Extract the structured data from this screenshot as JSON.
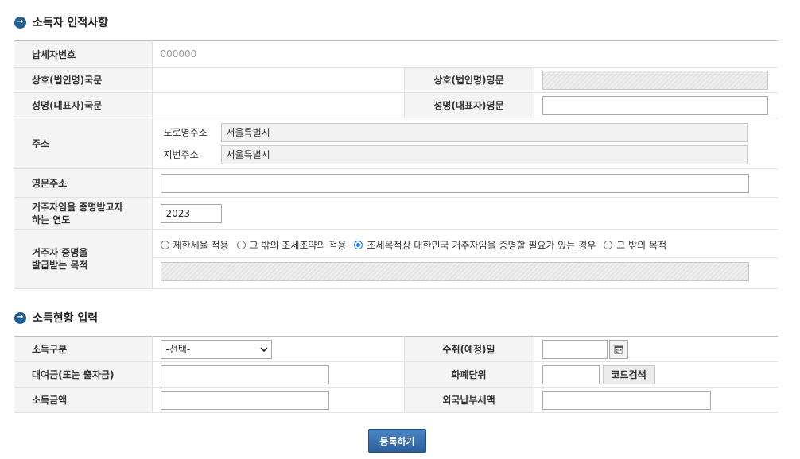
{
  "section1": {
    "title": "소득자 인적사항",
    "taxpayer_number_label": "납세자번호",
    "taxpayer_number_value": "000000",
    "company_kr_label": "상호(법인명)국문",
    "company_kr_value": "",
    "company_en_label": "상호(법인명)영문",
    "rep_kr_label": "성명(대표자)국문",
    "rep_kr_value": "",
    "rep_en_label": "성명(대표자)영문",
    "address_label": "주소",
    "road_address_label": "도로명주소",
    "road_address_value": "서울특별시 ",
    "lot_address_label": "지번주소",
    "lot_address_value": "서울특별시 ",
    "english_address_label": "영문주소",
    "residence_year_label_1": "거주자임을 증명받고자",
    "residence_year_label_2": "하는 연도",
    "residence_year_value": "2023",
    "purpose_label_1": "거주자 증명을",
    "purpose_label_2": "발급받는 목적",
    "purpose_options": [
      {
        "label": "제한세율 적용",
        "checked": false
      },
      {
        "label": "그 밖의 조세조약의 적용",
        "checked": false
      },
      {
        "label": "조세목적상 대한민국 거주자임을 증명할 필요가 있는 경우",
        "checked": true
      },
      {
        "label": "그 밖의 목적",
        "checked": false
      }
    ]
  },
  "section2": {
    "title": "소득현황 입력",
    "income_type_label": "소득구분",
    "income_type_selected": "-선택-",
    "receipt_date_label": "수취(예정)일",
    "loan_label": "대여금(또는 출자금)",
    "currency_label": "화폐단위",
    "code_search_label": "코드검색",
    "income_amount_label": "소득금액",
    "foreign_tax_label": "외국납부세액"
  },
  "submit_label": "등록하기",
  "colors": {
    "accent": "#1e5f94",
    "button": "#2b5f9b"
  }
}
